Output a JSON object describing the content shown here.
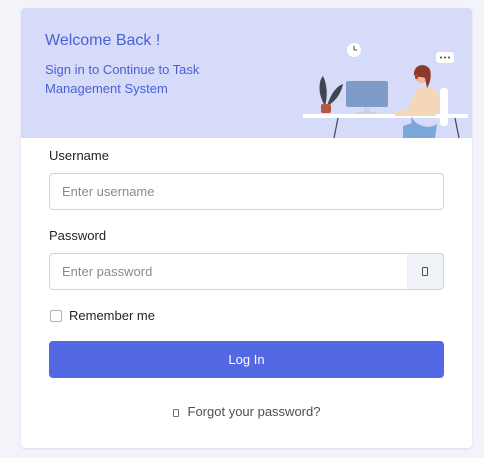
{
  "banner": {
    "title": "Welcome Back !",
    "subtitle": "Sign in to Continue to Task Management System",
    "illustration_icon": "person-at-desk-illustration"
  },
  "form": {
    "username_label": "Username",
    "username_placeholder": "Enter username",
    "username_value": "",
    "password_label": "Password",
    "password_placeholder": "Enter password",
    "password_value": "",
    "toggle_icon": "eye-icon",
    "remember_label": "Remember me",
    "remember_checked": false,
    "login_label": "Log In",
    "forgot_label": "Forgot your password?",
    "forgot_icon": "lock-icon"
  },
  "colors": {
    "accent": "#5468e4",
    "banner_bg": "#d6dbf9",
    "banner_text": "#4b5fd6",
    "page_bg": "#f3f3f9"
  }
}
